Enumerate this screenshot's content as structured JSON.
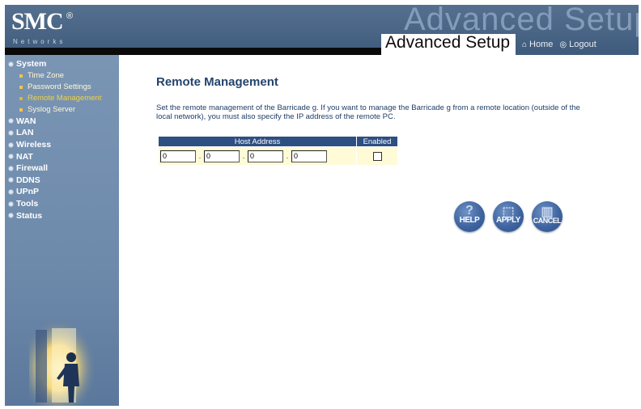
{
  "header": {
    "logo_text": "SMC",
    "logo_reg": "®",
    "logo_sub": "Networks",
    "background_text": "Advanced Setup",
    "title": "Advanced Setup",
    "home_label": "Home",
    "logout_label": "Logout"
  },
  "sidebar": {
    "items": [
      {
        "label": "System",
        "type": "section"
      },
      {
        "label": "Time Zone",
        "type": "sub"
      },
      {
        "label": "Password Settings",
        "type": "sub"
      },
      {
        "label": "Remote Management",
        "type": "sub",
        "active": true
      },
      {
        "label": "Syslog Server",
        "type": "sub"
      },
      {
        "label": "WAN",
        "type": "section"
      },
      {
        "label": "LAN",
        "type": "section"
      },
      {
        "label": "Wireless",
        "type": "section"
      },
      {
        "label": "NAT",
        "type": "section"
      },
      {
        "label": "Firewall",
        "type": "section"
      },
      {
        "label": "DDNS",
        "type": "section"
      },
      {
        "label": "UPnP",
        "type": "section"
      },
      {
        "label": "Tools",
        "type": "section"
      },
      {
        "label": "Status",
        "type": "section"
      }
    ]
  },
  "main": {
    "title": "Remote Management",
    "description": "Set the remote management of the Barricade g. If you want to manage the Barricade g from a remote location (outside of the local network), you must also specify the IP address of the remote PC.",
    "table": {
      "col_host": "Host Address",
      "col_enabled": "Enabled",
      "ip": [
        "0",
        "0",
        "0",
        "0"
      ],
      "enabled": false
    },
    "buttons": {
      "help": "HELP",
      "apply": "APPLY",
      "cancel": "CANCEL"
    }
  },
  "colors": {
    "header": "#4a6689",
    "sidebar": "#7390b0",
    "title": "#25436b",
    "table_header": "#2d4f82",
    "table_row": "#fffbd6",
    "active_nav": "#f2d23d"
  }
}
